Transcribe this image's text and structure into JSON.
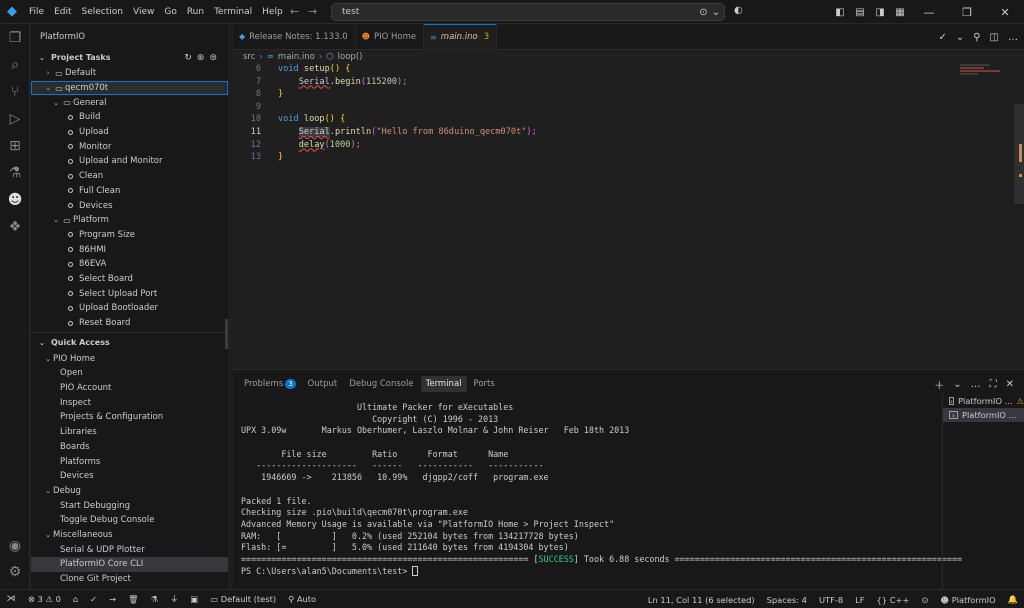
{
  "menu": [
    "File",
    "Edit",
    "Selection",
    "View",
    "Go",
    "Run",
    "Terminal",
    "Help"
  ],
  "search": {
    "text": "test"
  },
  "sidebar": {
    "title": "PlatformIO",
    "project_tasks": {
      "header": "Project Tasks",
      "default_env": "Default",
      "env": "qecm070t",
      "general": {
        "label": "General",
        "items": [
          "Build",
          "Upload",
          "Monitor",
          "Upload and Monitor",
          "Clean",
          "Full Clean",
          "Devices"
        ]
      },
      "platform": {
        "label": "Platform",
        "items": [
          "Program Size",
          "86HMI",
          "86EVA",
          "Select Board",
          "Select Upload Port",
          "Upload Bootloader",
          "Reset Board"
        ]
      }
    },
    "quick_access": {
      "header": "Quick Access",
      "pio_home": {
        "label": "PIO Home",
        "items": [
          "Open",
          "PIO Account",
          "Inspect",
          "Projects & Configuration",
          "Libraries",
          "Boards",
          "Platforms",
          "Devices"
        ]
      },
      "debug": {
        "label": "Debug",
        "items": [
          "Start Debugging",
          "Toggle Debug Console"
        ]
      },
      "misc": {
        "label": "Miscellaneous",
        "items": [
          "Serial & UDP Plotter",
          "PlatformIO Core CLI",
          "Clone Git Project"
        ]
      }
    }
  },
  "tabs": [
    {
      "label": "Release Notes: 1.133.0",
      "icon": "vscode-icon"
    },
    {
      "label": "PIO Home",
      "icon": "pio-icon"
    },
    {
      "label": "main.ino",
      "badge": "3",
      "icon": "arduino-icon"
    }
  ],
  "breadcrumb": [
    "src",
    "main.ino",
    "loop()"
  ],
  "code": {
    "line_numbers": [
      "6",
      "7",
      "8",
      "9",
      "10",
      "11",
      "12",
      "13"
    ],
    "setup_kw": "void",
    "setup_fn": "setup",
    "setup_rest": "() {",
    "l7_obj": "Serial",
    "l7_dot": ".",
    "l7_fn": "begin",
    "l7_open": "(",
    "l7_num": "115200",
    "l7_close": ");",
    "l8": "}",
    "loop_kw": "void",
    "loop_fn": "loop",
    "loop_rest": "() {",
    "l11_obj": "Serial",
    "l11_dot": ".",
    "l11_fn": "println",
    "l11_open": "(",
    "l11_str": "\"Hello from 86duino_qecm070t\"",
    "l11_close": ");",
    "l12_fn": "delay",
    "l12_open": "(",
    "l12_num": "1000",
    "l12_close": ");",
    "l13": "}"
  },
  "panel": {
    "tabs": [
      "Problems",
      "Output",
      "Debug Console",
      "Terminal",
      "Ports"
    ],
    "problems_badge": "3",
    "terminal_lines": [
      "                       Ultimate Packer for eXecutables",
      "                          Copyright (C) 1996 - 2013",
      "UPX 3.09w       Markus Oberhumer, Laszlo Molnar & John Reiser   Feb 18th 2013",
      "",
      "        File size         Ratio      Format      Name",
      "   --------------------   ------   -----------   -----------",
      "    1946669 ->    213856   10.99%   djgpp2/coff   program.exe",
      "",
      "Packed 1 file.",
      "Checking size .pio\\build\\qecm070t\\program.exe",
      "Advanced Memory Usage is available via \"PlatformIO Home > Project Inspect\"",
      "RAM:   [          ]   0.2% (used 252104 bytes from 134217728 bytes)",
      "Flash: [=         ]   5.0% (used 211640 bytes from 4194304 bytes)"
    ],
    "success_prefix": "========================================================= [",
    "success_word": "SUCCESS",
    "success_suffix": "] Took 6.88 seconds =========================================================",
    "prompt": "PS C:\\Users\\alan5\\Documents\\test> ",
    "terminals": [
      "PlatformIO ...",
      "PlatformIO ..."
    ]
  },
  "status": {
    "errors": "3",
    "warnings": "0",
    "env": "Default (test)",
    "auto": "Auto",
    "position": "Ln 11, Col 11 (6 selected)",
    "spaces": "Spaces: 4",
    "encoding": "UTF-8",
    "eol": "LF",
    "language": "C++",
    "platformio": "PlatformIO"
  },
  "colors": {
    "accent": "#0078d4",
    "success": "#23d18b",
    "warning": "#cca700",
    "error": "#f14c4c"
  }
}
